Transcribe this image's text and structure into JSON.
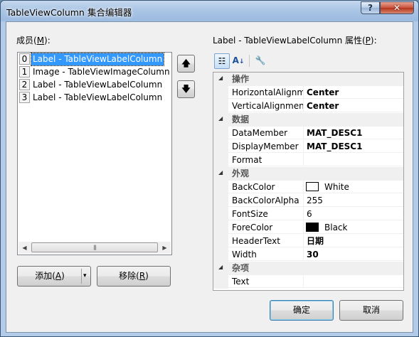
{
  "window": {
    "title": "TableViewColumn 集合编辑器",
    "help_glyph": "?",
    "close_glyph": "✕"
  },
  "members": {
    "label": "成员(",
    "label_key": "M",
    "label_end": "):",
    "items": [
      {
        "index": "0",
        "text": "Label - TableViewLabelColumn",
        "selected": true
      },
      {
        "index": "1",
        "text": "Image - TableViewImageColumn",
        "selected": false
      },
      {
        "index": "2",
        "text": "Label - TableViewLabelColumn",
        "selected": false
      },
      {
        "index": "3",
        "text": "Label - TableViewLabelColumn",
        "selected": false
      }
    ],
    "scroll_left": "◀",
    "scroll_right": "▶",
    "scroll_thumb": "|||"
  },
  "move_buttons": {
    "up": "🡅",
    "down": "🡇"
  },
  "add_button": {
    "label": "添加(",
    "key": "A",
    "end": ")",
    "dropdown": "▾"
  },
  "remove_button": {
    "label": "移除(",
    "key": "R",
    "end": ")"
  },
  "properties": {
    "title_prefix": "Label - TableViewLabelColumn 属性(",
    "title_key": "P",
    "title_end": "):",
    "toolbar": {
      "categorized_icon": "☷",
      "alphabetical_icon": "↓",
      "property_pages_icon": "🔧"
    },
    "rows": [
      {
        "kind": "category",
        "label": "操作"
      },
      {
        "kind": "prop",
        "name": "HorizontalAlignment",
        "value": "Center",
        "bold": true
      },
      {
        "kind": "prop",
        "name": "VerticalAlignment",
        "value": "Center",
        "bold": true
      },
      {
        "kind": "category",
        "label": "数据"
      },
      {
        "kind": "prop",
        "name": "DataMember",
        "value": "MAT_DESC1",
        "bold": true
      },
      {
        "kind": "prop",
        "name": "DisplayMember",
        "value": "MAT_DESC1",
        "bold": true
      },
      {
        "kind": "prop",
        "name": "Format",
        "value": "",
        "bold": false
      },
      {
        "kind": "category",
        "label": "外观"
      },
      {
        "kind": "prop",
        "name": "BackColor",
        "value": "White",
        "bold": false,
        "swatch": "#ffffff"
      },
      {
        "kind": "prop",
        "name": "BackColorAlpha",
        "value": "255",
        "bold": false
      },
      {
        "kind": "prop",
        "name": "FontSize",
        "value": "6",
        "bold": false
      },
      {
        "kind": "prop",
        "name": "ForeColor",
        "value": "Black",
        "bold": false,
        "swatch": "#000000"
      },
      {
        "kind": "prop",
        "name": "HeaderText",
        "value": "日期",
        "bold": true
      },
      {
        "kind": "prop",
        "name": "Width",
        "value": "30",
        "bold": true
      },
      {
        "kind": "category",
        "label": "杂项"
      },
      {
        "kind": "prop",
        "name": "Text",
        "value": "",
        "bold": false
      }
    ]
  },
  "ok_button": {
    "label": "确定"
  },
  "cancel_button": {
    "label": "取消"
  },
  "colors": {
    "selection": "#3399ff",
    "dialog_bg": "#f0f0f0",
    "title_glass": "#a9c4e4",
    "close_red": "#c8533c"
  }
}
